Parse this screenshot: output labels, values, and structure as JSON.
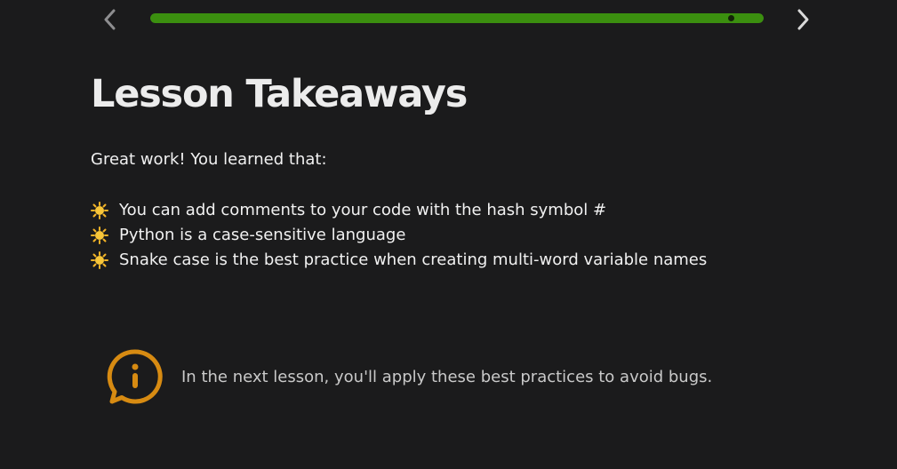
{
  "header": {
    "prev_icon": "chevron-left-icon",
    "next_icon": "chevron-right-icon",
    "progress_fraction": 0.95
  },
  "lesson": {
    "title": "Lesson Takeaways",
    "intro": "Great work! You learned that:",
    "bullet_icon": "sun-emoji-icon",
    "takeaways": [
      "You can add comments to your code with the hash symbol #",
      "Python is a case-sensitive language",
      "Snake case is the best practice when creating multi-word variable names"
    ]
  },
  "callout": {
    "icon": "info-speech-bubble-icon",
    "text": "In the next lesson, you'll apply these best practices to avoid bugs."
  },
  "colors": {
    "background": "#1b1b1c",
    "progress_fill": "#3b8f0f",
    "callout_accent": "#d78b12"
  }
}
